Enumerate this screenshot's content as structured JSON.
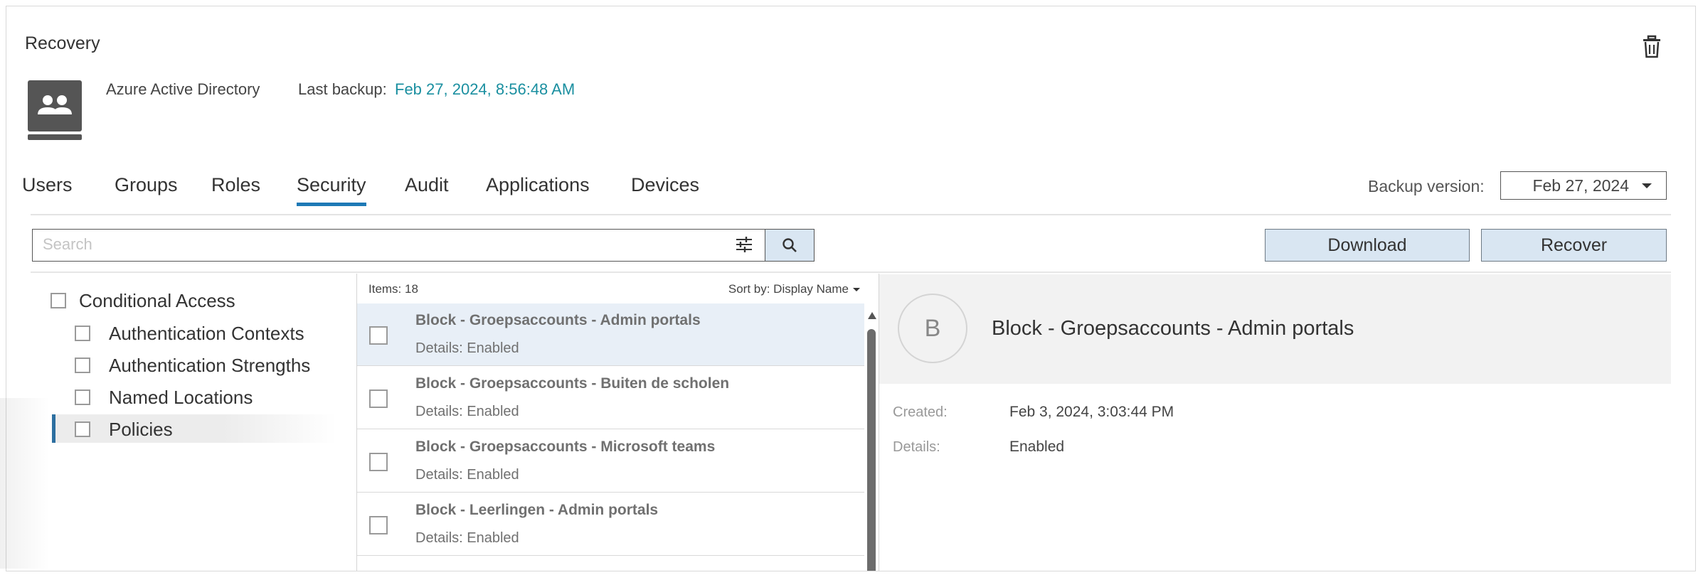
{
  "page": {
    "title": "Recovery"
  },
  "source": {
    "name": "Azure Active Directory",
    "last_backup_label": "Last backup:",
    "last_backup_value": "Feb 27, 2024, 8:56:48 AM"
  },
  "tabs": [
    {
      "label": "Users",
      "active": false
    },
    {
      "label": "Groups",
      "active": false
    },
    {
      "label": "Roles",
      "active": false
    },
    {
      "label": "Security",
      "active": true
    },
    {
      "label": "Audit",
      "active": false
    },
    {
      "label": "Applications",
      "active": false
    },
    {
      "label": "Devices",
      "active": false
    }
  ],
  "backup_version": {
    "label": "Backup version:",
    "value": "Feb 27, 2024"
  },
  "search": {
    "placeholder": "Search"
  },
  "actions": {
    "download": "Download",
    "recover": "Recover"
  },
  "tree": {
    "root": "Conditional Access",
    "children": [
      "Authentication Contexts",
      "Authentication Strengths",
      "Named Locations",
      "Policies"
    ],
    "selected": "Policies"
  },
  "list": {
    "count_label": "Items: 18",
    "sort_label": "Sort by: Display Name",
    "items": [
      {
        "title": "Block - Groepsaccounts - Admin portals",
        "details": "Details: Enabled"
      },
      {
        "title": "Block - Groepsaccounts - Buiten de scholen",
        "details": "Details: Enabled"
      },
      {
        "title": "Block - Groepsaccounts - Microsoft teams",
        "details": "Details: Enabled"
      },
      {
        "title": "Block - Leerlingen - Admin portals",
        "details": "Details: Enabled"
      }
    ]
  },
  "detail": {
    "avatar_letter": "B",
    "title": "Block - Groepsaccounts - Admin portals",
    "created_label": "Created:",
    "created_value": "Feb 3, 2024, 3:03:44 PM",
    "details_label": "Details:",
    "details_value": "Enabled"
  },
  "colors": {
    "accent": "#1d79b6",
    "link_teal": "#1a8fa0",
    "button_bg": "#d9e6f2",
    "selected_row": "#e8eff7"
  },
  "icons": [
    "trash-icon",
    "users-group-icon",
    "filter-sliders-icon",
    "search-icon",
    "caret-down-icon"
  ]
}
